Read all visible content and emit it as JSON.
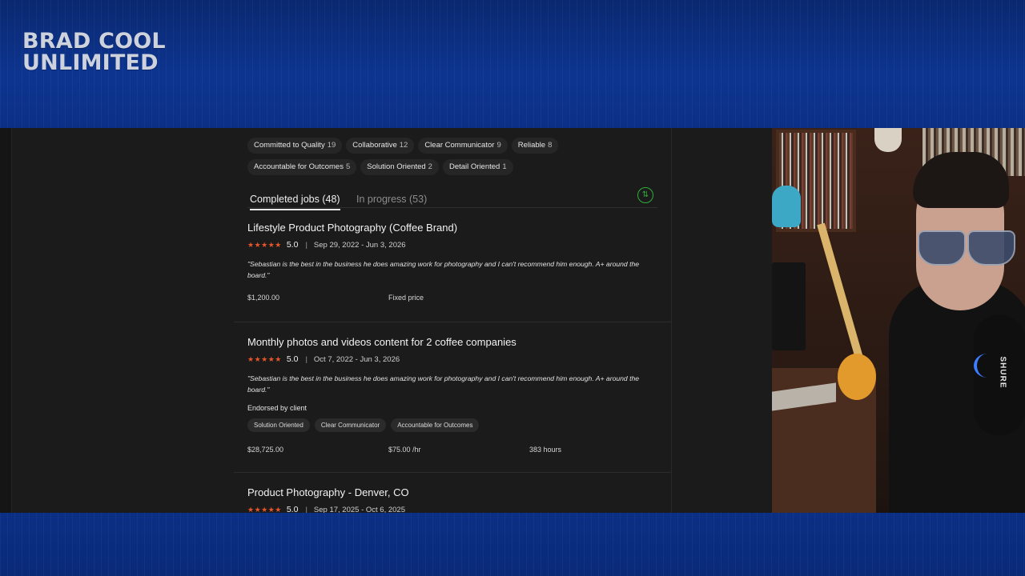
{
  "brand": {
    "line1": "BRAD COOL",
    "line2": "UNLIMITED"
  },
  "skill_chips": [
    {
      "label": "Committed to Quality",
      "count": "19"
    },
    {
      "label": "Collaborative",
      "count": "12"
    },
    {
      "label": "Clear Communicator",
      "count": "9"
    },
    {
      "label": "Reliable",
      "count": "8"
    },
    {
      "label": "Accountable for Outcomes",
      "count": "5"
    },
    {
      "label": "Solution Oriented",
      "count": "2"
    },
    {
      "label": "Detail Oriented",
      "count": "1"
    }
  ],
  "tabs": [
    {
      "label": "Completed jobs (48)",
      "active": true
    },
    {
      "label": "In progress (53)",
      "active": false
    }
  ],
  "sort_icon": "sort-arrows-icon",
  "jobs": [
    {
      "title": "Lifestyle Product Photography (Coffee Brand)",
      "stars": "★★★★★",
      "score": "5.0",
      "dates": "Sep 29, 2022 - Jun 3, 2026",
      "review": "\"Sebastian is the best in the business he does amazing work for photography and I can't recommend him enough. A+ around the board.\"",
      "earned": "$1,200.00",
      "rate": "Fixed price"
    },
    {
      "title": "Monthly photos and videos content for 2 coffee companies",
      "stars": "★★★★★",
      "score": "5.0",
      "dates": "Oct 7, 2022 - Jun 3, 2026",
      "review": "\"Sebastian is the best in the business he does amazing work for photography and I can't recommend him enough. A+ around the board.\"",
      "endorsed_label": "Endorsed by client",
      "tags": [
        "Solution Oriented",
        "Clear Communicator",
        "Accountable for Outcomes"
      ],
      "earned": "$28,725.00",
      "rate": "$75.00 /hr",
      "hours": "383 hours"
    },
    {
      "title": "Product Photography - Denver, CO",
      "stars": "★★★★★",
      "score": "5.0",
      "dates": "Sep 17, 2025 - Oct 6, 2025"
    }
  ],
  "webcam": {
    "mic_label": "SHURE"
  },
  "colors": {
    "star": "#e8552a",
    "sort_accent": "#2fae3a",
    "banner": "#0d3590",
    "panel": "#1b1b1b"
  }
}
